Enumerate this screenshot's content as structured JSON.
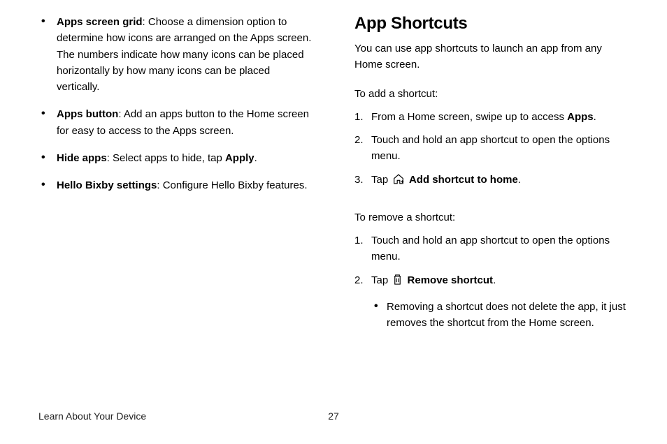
{
  "left": {
    "items": [
      {
        "term": "Apps screen grid",
        "desc": ": Choose a dimension option to determine how icons are arranged on the Apps screen. The numbers indicate how many icons can be placed horizontally by how many icons can be placed vertically."
      },
      {
        "term": "Apps button",
        "desc": ": Add an apps button to the Home screen for easy to access to the Apps screen."
      },
      {
        "term": "Hide apps",
        "desc": ": Select apps to hide, tap ",
        "tail_bold": "Apply",
        "tail": "."
      },
      {
        "term": "Hello Bixby settings",
        "desc": ": Configure Hello Bixby features."
      }
    ]
  },
  "right": {
    "heading": "App Shortcuts",
    "intro": "You can use app shortcuts to launch an app from any Home screen.",
    "add": {
      "lead": "To add a shortcut:",
      "steps": {
        "s1a": "From a Home screen, swipe up to access ",
        "s1b": "Apps",
        "s1c": ".",
        "s2": "Touch and hold an app shortcut to open the options menu.",
        "s3a": "Tap ",
        "s3b": " Add shortcut to home",
        "s3c": "."
      }
    },
    "remove": {
      "lead": "To remove a shortcut:",
      "steps": {
        "s1": "Touch and hold an app shortcut to open the options menu.",
        "s2a": "Tap ",
        "s2b": " Remove shortcut",
        "s2c": ".",
        "note": "Removing a shortcut does not delete the app, it just removes the shortcut from the Home screen."
      }
    }
  },
  "footer": {
    "title": "Learn About Your Device",
    "page": "27"
  }
}
